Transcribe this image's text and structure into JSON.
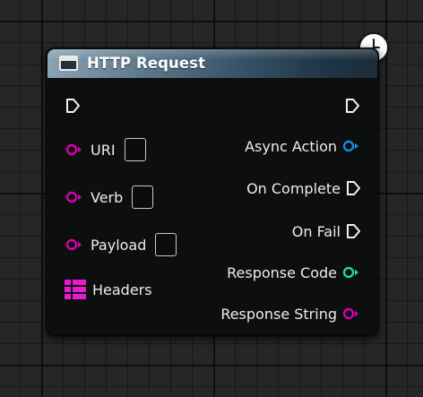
{
  "node": {
    "title": "HTTP Request",
    "header_icon": "function-window-icon",
    "latent_badge_icon": "clock-icon",
    "exec_in": {
      "icon": "exec-arrow-icon"
    },
    "exec_out": {
      "icon": "exec-arrow-icon"
    },
    "inputs": [
      {
        "label": "URI",
        "type": "string",
        "color": "#d600b0",
        "has_value_box": true
      },
      {
        "label": "Verb",
        "type": "string",
        "color": "#d600b0",
        "has_value_box": true
      },
      {
        "label": "Payload",
        "type": "string",
        "color": "#d600b0",
        "has_value_box": true
      },
      {
        "label": "Headers",
        "type": "map",
        "color": "#e81ad1",
        "icon": "map-grid-icon"
      }
    ],
    "outputs": [
      {
        "label": "Async Action",
        "type": "object",
        "color": "#0f8fd8"
      },
      {
        "label": "On Complete",
        "type": "exec",
        "icon": "exec-arrow-icon"
      },
      {
        "label": "On Fail",
        "type": "exec",
        "icon": "exec-arrow-icon"
      },
      {
        "label": "Response Code",
        "type": "integer",
        "color": "#1fd8a0"
      },
      {
        "label": "Response String",
        "type": "string",
        "color": "#d600b0"
      }
    ]
  },
  "colors": {
    "canvas_bg": "#262626",
    "string_pin": "#d600b0",
    "object_pin": "#0f8fd8",
    "integer_pin": "#1fd8a0",
    "exec_pin": "#ffffff"
  }
}
